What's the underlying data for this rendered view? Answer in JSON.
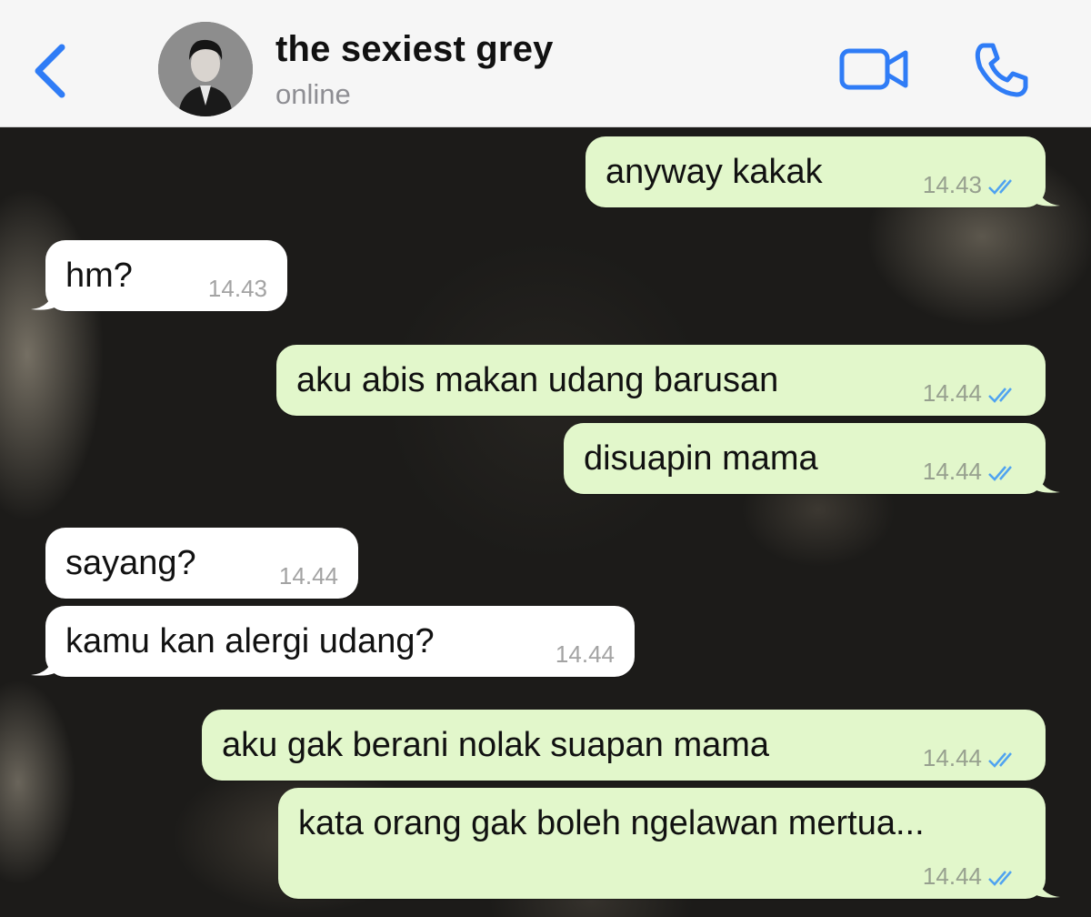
{
  "header": {
    "contact_name": "the sexiest grey",
    "status": "online",
    "back_icon": "chevron-left-icon",
    "video_icon": "video-camera-icon",
    "call_icon": "phone-icon",
    "accent_color": "#2f7cf6"
  },
  "colors": {
    "outgoing_bubble": "#e2f7cb",
    "incoming_bubble": "#ffffff",
    "read_ticks": "#4fa3f0"
  },
  "messages": [
    {
      "direction": "out",
      "text": "anyway kakak",
      "time": "14.43",
      "read": true
    },
    {
      "direction": "in",
      "text": "hm?",
      "time": "14.43"
    },
    {
      "direction": "out",
      "text": "aku abis makan udang barusan",
      "time": "14.44",
      "read": true
    },
    {
      "direction": "out",
      "text": "disuapin mama",
      "time": "14.44",
      "read": true
    },
    {
      "direction": "in",
      "text": "sayang?",
      "time": "14.44"
    },
    {
      "direction": "in",
      "text": "kamu kan alergi udang?",
      "time": "14.44"
    },
    {
      "direction": "out",
      "text": "aku gak berani nolak suapan mama",
      "time": "14.44",
      "read": true
    },
    {
      "direction": "out",
      "text": "kata orang gak boleh ngelawan mertua...",
      "time": "14.44",
      "read": true
    }
  ]
}
